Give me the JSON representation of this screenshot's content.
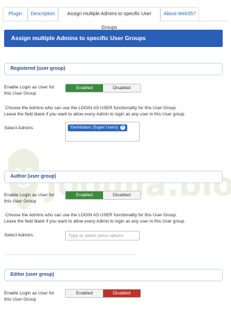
{
  "tabs": [
    {
      "label": "Plugin",
      "active": false
    },
    {
      "label": "Description",
      "active": false
    },
    {
      "label": "Assign multiple Admins to specific User Groups",
      "active": true
    },
    {
      "label": "About Web357",
      "active": false
    }
  ],
  "header": {
    "title": "Assign multiple Admins to specific User Groups"
  },
  "groups": [
    {
      "legend": "Registered (user group)",
      "enable_label": "Enable Login as User for this User Group",
      "toggle": {
        "enabled": "Enabled",
        "disabled": "Disabled",
        "state": "enabled"
      },
      "desc_line1": "Choose the Admins who can use the LOGIN AS USER functionality for this User Group.",
      "desc_line2": "Leave the field blank if you want to allow every Admin to login as any user in this User group.",
      "select_label": "Select Admins",
      "selected": [
        "Yiannistaos (Super Users)"
      ],
      "placeholder": ""
    },
    {
      "legend": "Author (user group)",
      "enable_label": "Enable Login as User for this User Group",
      "toggle": {
        "enabled": "Enabled",
        "disabled": "Disabled",
        "state": "enabled"
      },
      "desc_line1": "Choose the Admins who can use the LOGIN AS USER functionality for this User Group.",
      "desc_line2": "Leave the field blank if you want to allow every Admin to login as any user in this User group.",
      "select_label": "Select Admins",
      "selected": [],
      "placeholder": "Type or select some options"
    },
    {
      "legend": "Editor (user group)",
      "enable_label": "Enable Login as User for this User Group",
      "toggle": {
        "enabled": "Enabled",
        "disabled": "Disabled",
        "state": "disabled"
      }
    }
  ],
  "watermark": {
    "text": "Joomla.bio"
  },
  "colors": {
    "brand_blue": "#2a5fb8",
    "enabled_green": "#3b8a3e",
    "disabled_red": "#c0312b",
    "link": "#2a69b8"
  }
}
